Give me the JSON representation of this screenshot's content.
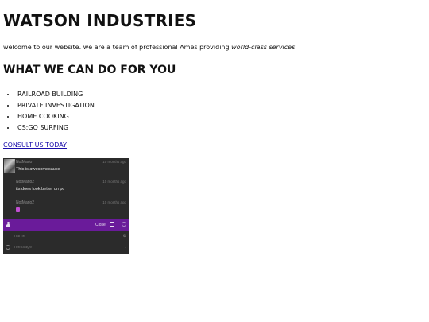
{
  "header": {
    "title": "WATSON INDUSTRIES"
  },
  "intro": {
    "text": "welcome to our website. we are a team of professional Ames providing ",
    "emphasis": "world-class services",
    "end": "."
  },
  "services_section": {
    "heading": "WHAT WE CAN DO FOR YOU",
    "items": [
      "RAILROAD BUILDING",
      "PRIVATE INVESTIGATION",
      "HOME COOKING",
      "CS:GO SURFING"
    ]
  },
  "cta": {
    "label": "CONSULT US TODAY"
  },
  "chat": {
    "messages": [
      {
        "user": "NotMario",
        "time": "10 months ago",
        "text": "This is awesomesauce",
        "has_avatar": true
      },
      {
        "user": "NotMario2",
        "time": "10 months ago",
        "text": "its does look better on pc",
        "has_avatar": false
      },
      {
        "user": "NotMario2",
        "time": "10 months ago",
        "text": "",
        "emoji": "purple-emoji",
        "has_avatar": false
      }
    ],
    "bar": {
      "close_label": "Close",
      "icons": [
        "person-icon",
        "popout-icon",
        "circle-icon"
      ],
      "color": "#6a1b9a"
    },
    "name_placeholder": "name",
    "message_placeholder": "message",
    "background": "#2b2b2b"
  }
}
